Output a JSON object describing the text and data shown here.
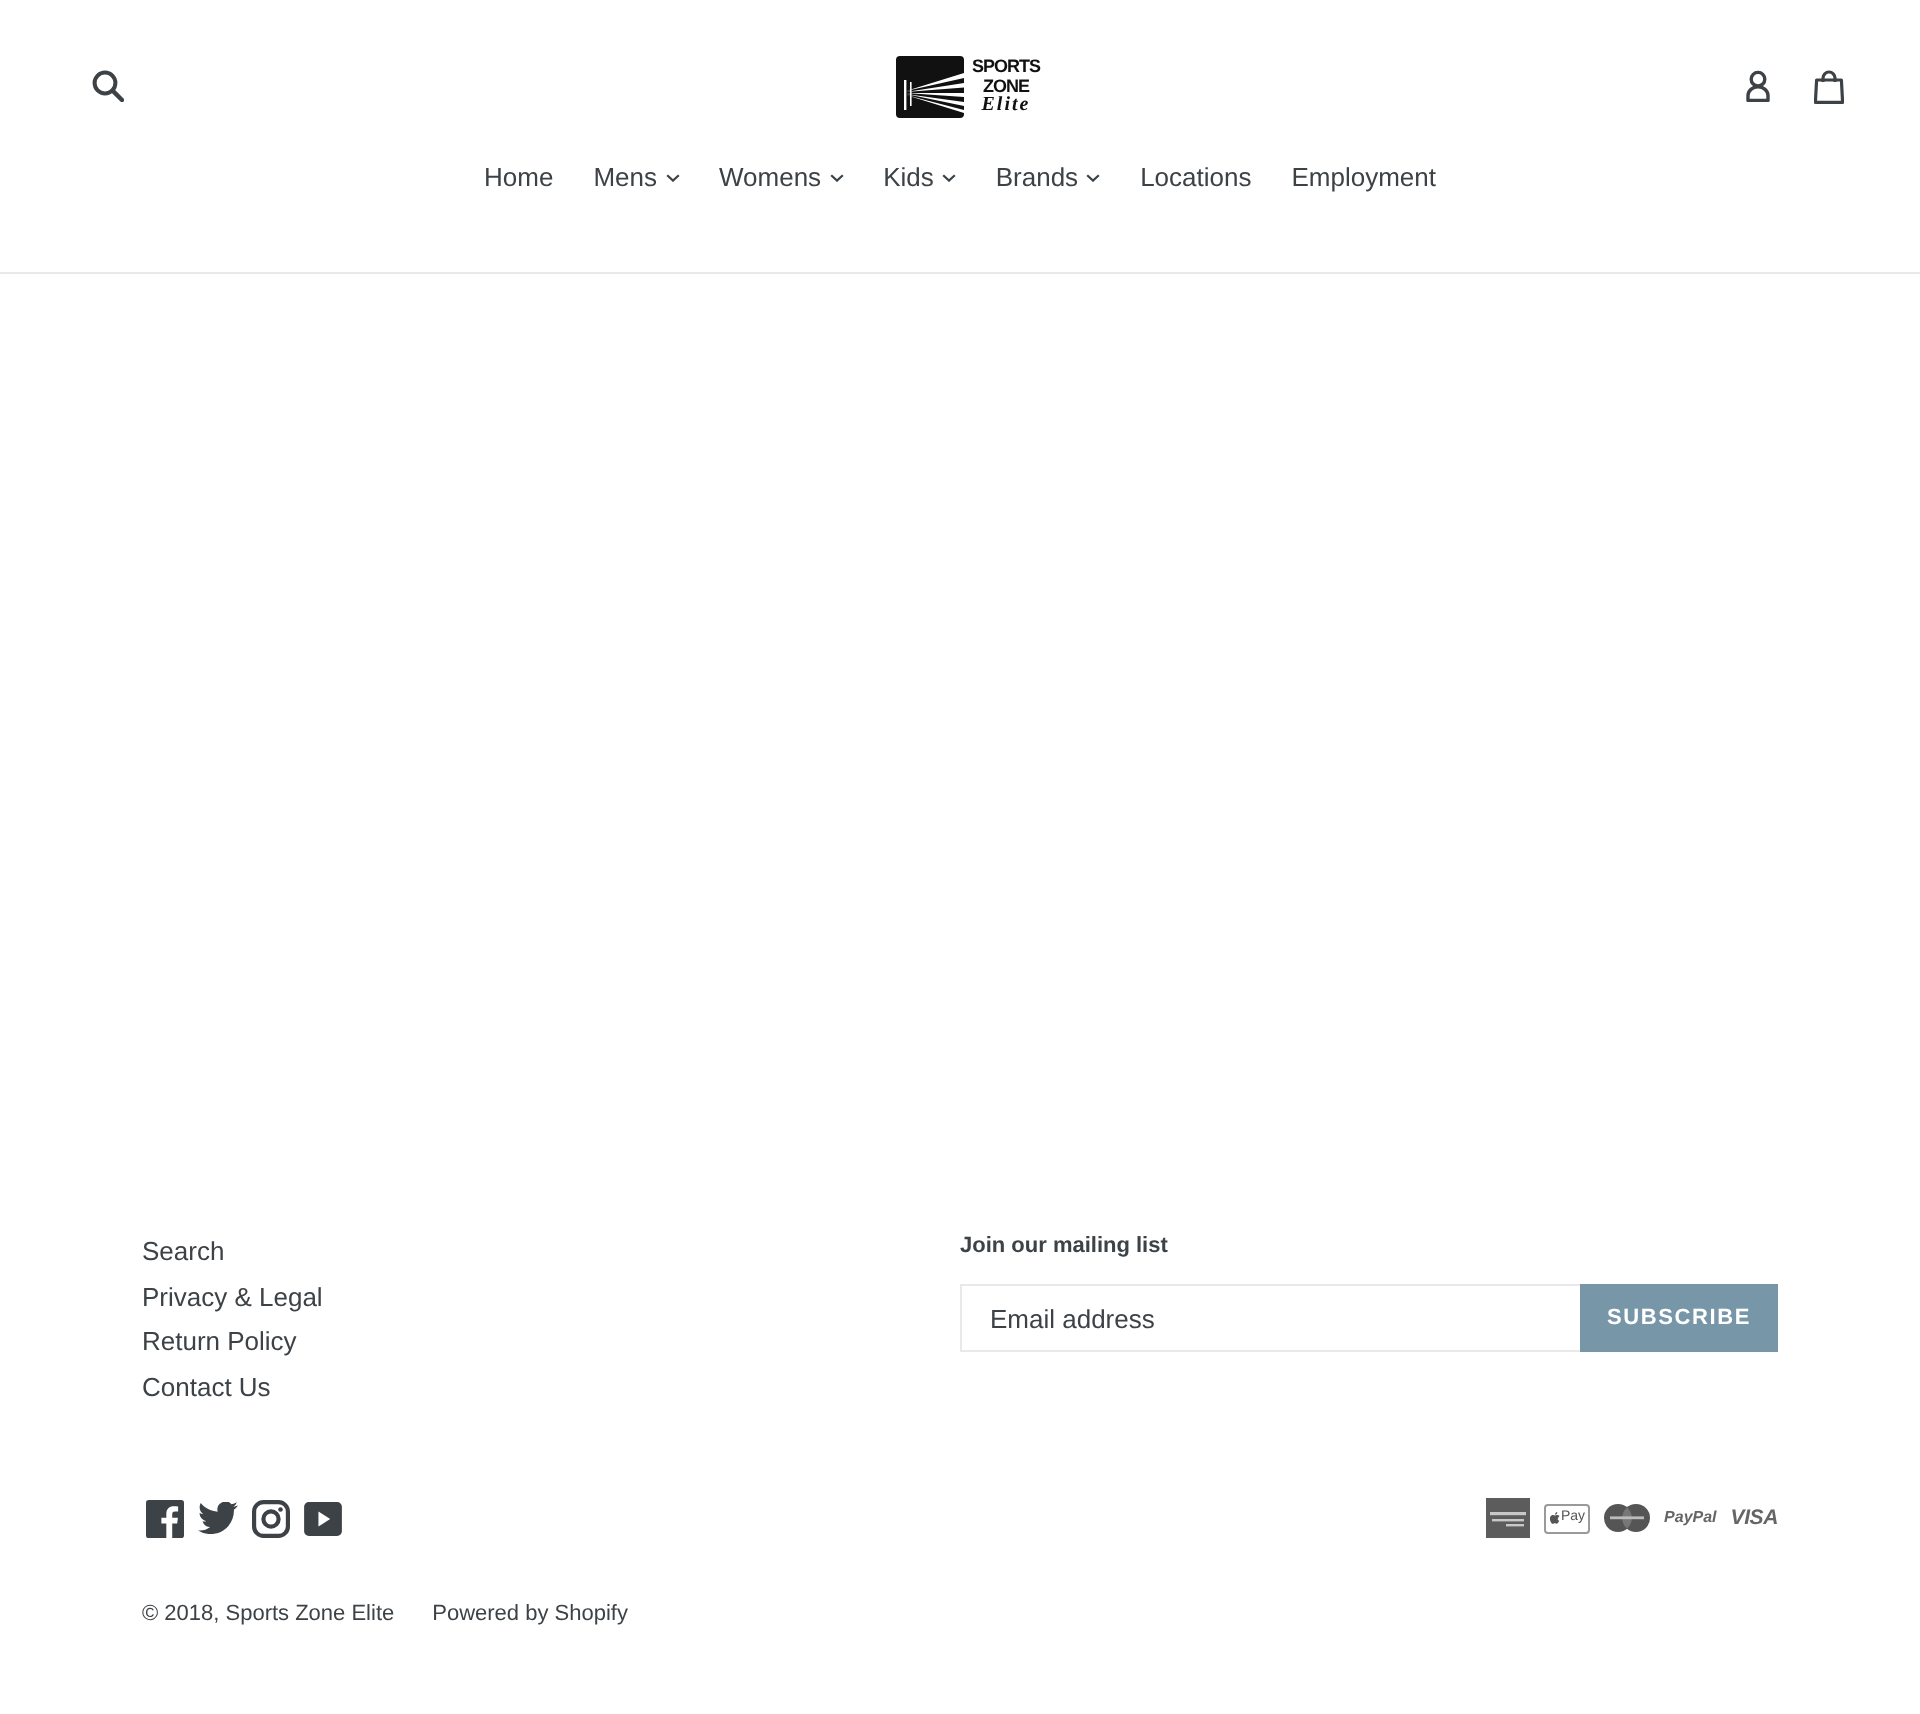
{
  "header": {
    "logo": {
      "lines": [
        {
          "text": "SPORTS",
          "kind": "block"
        },
        {
          "text": "ZONE",
          "kind": "block"
        },
        {
          "text": "Elite",
          "kind": "script"
        }
      ]
    },
    "nav": [
      {
        "label": "Home",
        "dropdown": false
      },
      {
        "label": "Mens",
        "dropdown": true
      },
      {
        "label": "Womens",
        "dropdown": true
      },
      {
        "label": "Kids",
        "dropdown": true
      },
      {
        "label": "Brands",
        "dropdown": true
      },
      {
        "label": "Locations",
        "dropdown": false
      },
      {
        "label": "Employment",
        "dropdown": false
      }
    ]
  },
  "footer": {
    "links": [
      "Search",
      "Privacy & Legal",
      "Return Policy",
      "Contact Us"
    ],
    "newsletter": {
      "title": "Join our mailing list",
      "placeholder": "Email address",
      "button": "SUBSCRIBE"
    },
    "social": [
      {
        "kind": "facebook"
      },
      {
        "kind": "twitter"
      },
      {
        "kind": "instagram"
      },
      {
        "kind": "youtube"
      }
    ],
    "payment_methods": [
      {
        "kind": "amex"
      },
      {
        "kind": "apple_pay",
        "label": "Pay"
      },
      {
        "kind": "mastercard"
      },
      {
        "kind": "paypal",
        "label": "PayPal"
      },
      {
        "kind": "visa",
        "label": "VISA"
      }
    ],
    "copyright": "© 2018, Sports Zone Elite",
    "powered_by": "Powered by Shopify"
  }
}
